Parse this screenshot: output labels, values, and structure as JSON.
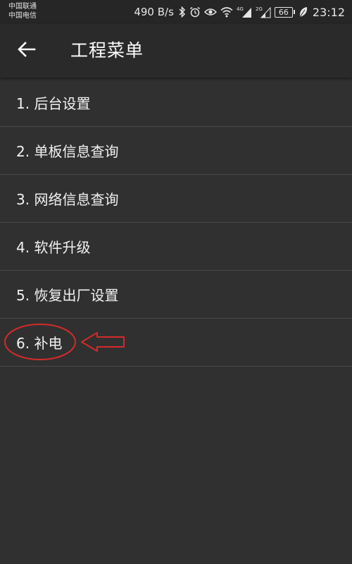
{
  "status_bar": {
    "carrier_1": "中国联通",
    "carrier_2": "中国电信",
    "net_speed": "490 B/s",
    "battery_level": "66",
    "time": "23:12",
    "icons": [
      "bluetooth-icon",
      "alarm-icon",
      "eye-icon",
      "wifi-icon",
      "signal-4g-icon",
      "signal-2g-icon",
      "battery-icon",
      "leaf-icon"
    ],
    "net_4g": "4G",
    "net_2g": "2G"
  },
  "app_bar": {
    "title": "工程菜单",
    "back_icon": "arrow-left-icon"
  },
  "menu": {
    "items": [
      {
        "label": "1. 后台设置"
      },
      {
        "label": "2. 单板信息查询"
      },
      {
        "label": "3. 网络信息查询"
      },
      {
        "label": "4. 软件升级"
      },
      {
        "label": "5. 恢复出厂设置"
      },
      {
        "label": "6. 补电"
      }
    ]
  },
  "colors": {
    "background": "#303030",
    "app_bar": "#2a2a2a",
    "status_bar": "#262626",
    "divider": "#4a4a4a",
    "annotation": "#d42a2a"
  }
}
